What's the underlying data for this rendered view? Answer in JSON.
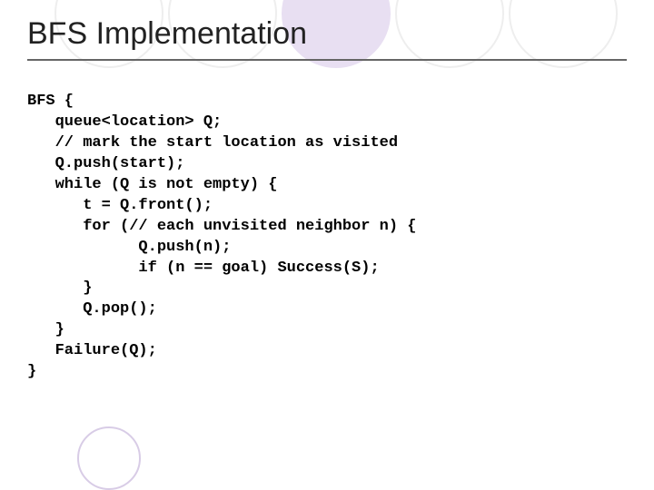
{
  "title": "BFS Implementation",
  "code": {
    "l1": "BFS {",
    "l2": "   queue<location> Q;",
    "l3": "   // mark the start location as visited",
    "l4": "   Q.push(start);",
    "l5": "   while (Q is not empty) {",
    "l6": "      t = Q.front();",
    "l7": "      for (// each unvisited neighbor n) {",
    "l8": "            Q.push(n);",
    "l9": "            if (n == goal) Success(S);",
    "l10": "      }",
    "l11": "      Q.pop();",
    "l12": "   }",
    "l13": "   Failure(Q);",
    "l14": "}"
  }
}
